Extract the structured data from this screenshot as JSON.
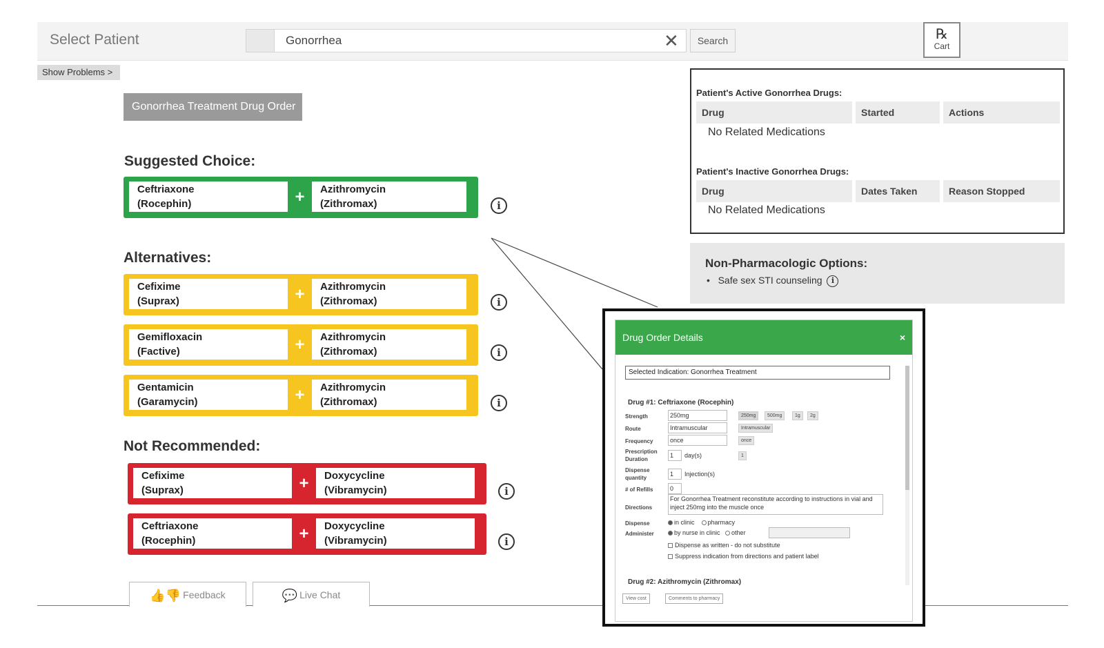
{
  "header": {
    "select_patient": "Select Patient",
    "search_value": "Gonorrhea",
    "search_button": "Search",
    "cart_rx": "℞",
    "cart_label": "Cart"
  },
  "show_problems": "Show Problems >",
  "order_title": "Gonorrhea Treatment Drug Order",
  "suggested": {
    "heading": "Suggested Choice:",
    "options": [
      {
        "drug_a": [
          "Ceftriaxone",
          "(Rocephin)"
        ],
        "drug_b": [
          "Azithromycin",
          "(Zithromax)"
        ]
      }
    ]
  },
  "alternatives": {
    "heading": "Alternatives:",
    "options": [
      {
        "drug_a": [
          "Cefixime",
          "(Suprax)"
        ],
        "drug_b": [
          "Azithromycin",
          "(Zithromax)"
        ]
      },
      {
        "drug_a": [
          "Gemifloxacin",
          "(Factive)"
        ],
        "drug_b": [
          "Azithromycin",
          "(Zithromax)"
        ]
      },
      {
        "drug_a": [
          "Gentamicin",
          "(Garamycin)"
        ],
        "drug_b": [
          "Azithromycin",
          "(Zithromax)"
        ]
      }
    ]
  },
  "not_recommended": {
    "heading": "Not Recommended:",
    "options": [
      {
        "drug_a": [
          "Cefixime",
          "(Suprax)"
        ],
        "drug_b": [
          "Doxycycline",
          "(Vibramycin)"
        ]
      },
      {
        "drug_a": [
          "Ceftriaxone",
          "(Rocephin)"
        ],
        "drug_b": [
          "Doxycycline",
          "(Vibramycin)"
        ]
      }
    ]
  },
  "plus_symbol": "+",
  "info_symbol": "i",
  "active_drugs": {
    "heading": "Patient's Active Gonorrhea Drugs:",
    "columns": [
      "Drug",
      "Started",
      "Actions"
    ],
    "empty": "No Related Medications"
  },
  "inactive_drugs": {
    "heading": "Patient's Inactive Gonorrhea Drugs:",
    "columns": [
      "Drug",
      "Dates Taken",
      "Reason Stopped"
    ],
    "empty": "No Related Medications"
  },
  "non_pharm": {
    "heading": "Non-Pharmacologic Options:",
    "items": [
      "Safe sex STI counseling"
    ]
  },
  "footer": {
    "feedback": "Feedback",
    "live_chat": "Live Chat"
  },
  "modal": {
    "title": "Drug Order Details",
    "close": "×",
    "indication": "Selected Indication:  Gonorrhea Treatment",
    "drug1_heading": "Drug #1: Ceftriaxone (Rocephin)",
    "labels": {
      "strength": "Strength",
      "route": "Route",
      "frequency": "Frequency",
      "prescription_duration": "Prescription Duration",
      "dispense_quantity": "Dispense quantity",
      "refills": "# of Refills",
      "directions": "Directions",
      "dispense": "Dispense",
      "administer": "Administer"
    },
    "values": {
      "strength": "250mg",
      "route": "Intramuscular",
      "frequency": "once",
      "duration": "1",
      "duration_unit": "day(s)",
      "quantity": "1",
      "quantity_unit": "Injection(s)",
      "refills": "0",
      "directions": "For Gonorrhea Treatment reconstitute according to instructions in vial and inject 250mg into the muscle once"
    },
    "strength_options": [
      "250mg",
      "500mg",
      "1g",
      "2g"
    ],
    "route_options": [
      "Intramuscular"
    ],
    "frequency_options": [
      "once"
    ],
    "duration_options": [
      "1"
    ],
    "dispense_options": [
      "in clinic",
      "pharmacy"
    ],
    "administer_options": [
      "by nurse in clinic",
      "other"
    ],
    "checks": [
      "Dispense as written - do not substitute",
      "Suppress indication from directions and patient label"
    ],
    "drug2_heading": "Drug #2: Azithromycin (Zithromax)",
    "view_cost": "View cost",
    "comments": "Comments to pharmacy"
  }
}
